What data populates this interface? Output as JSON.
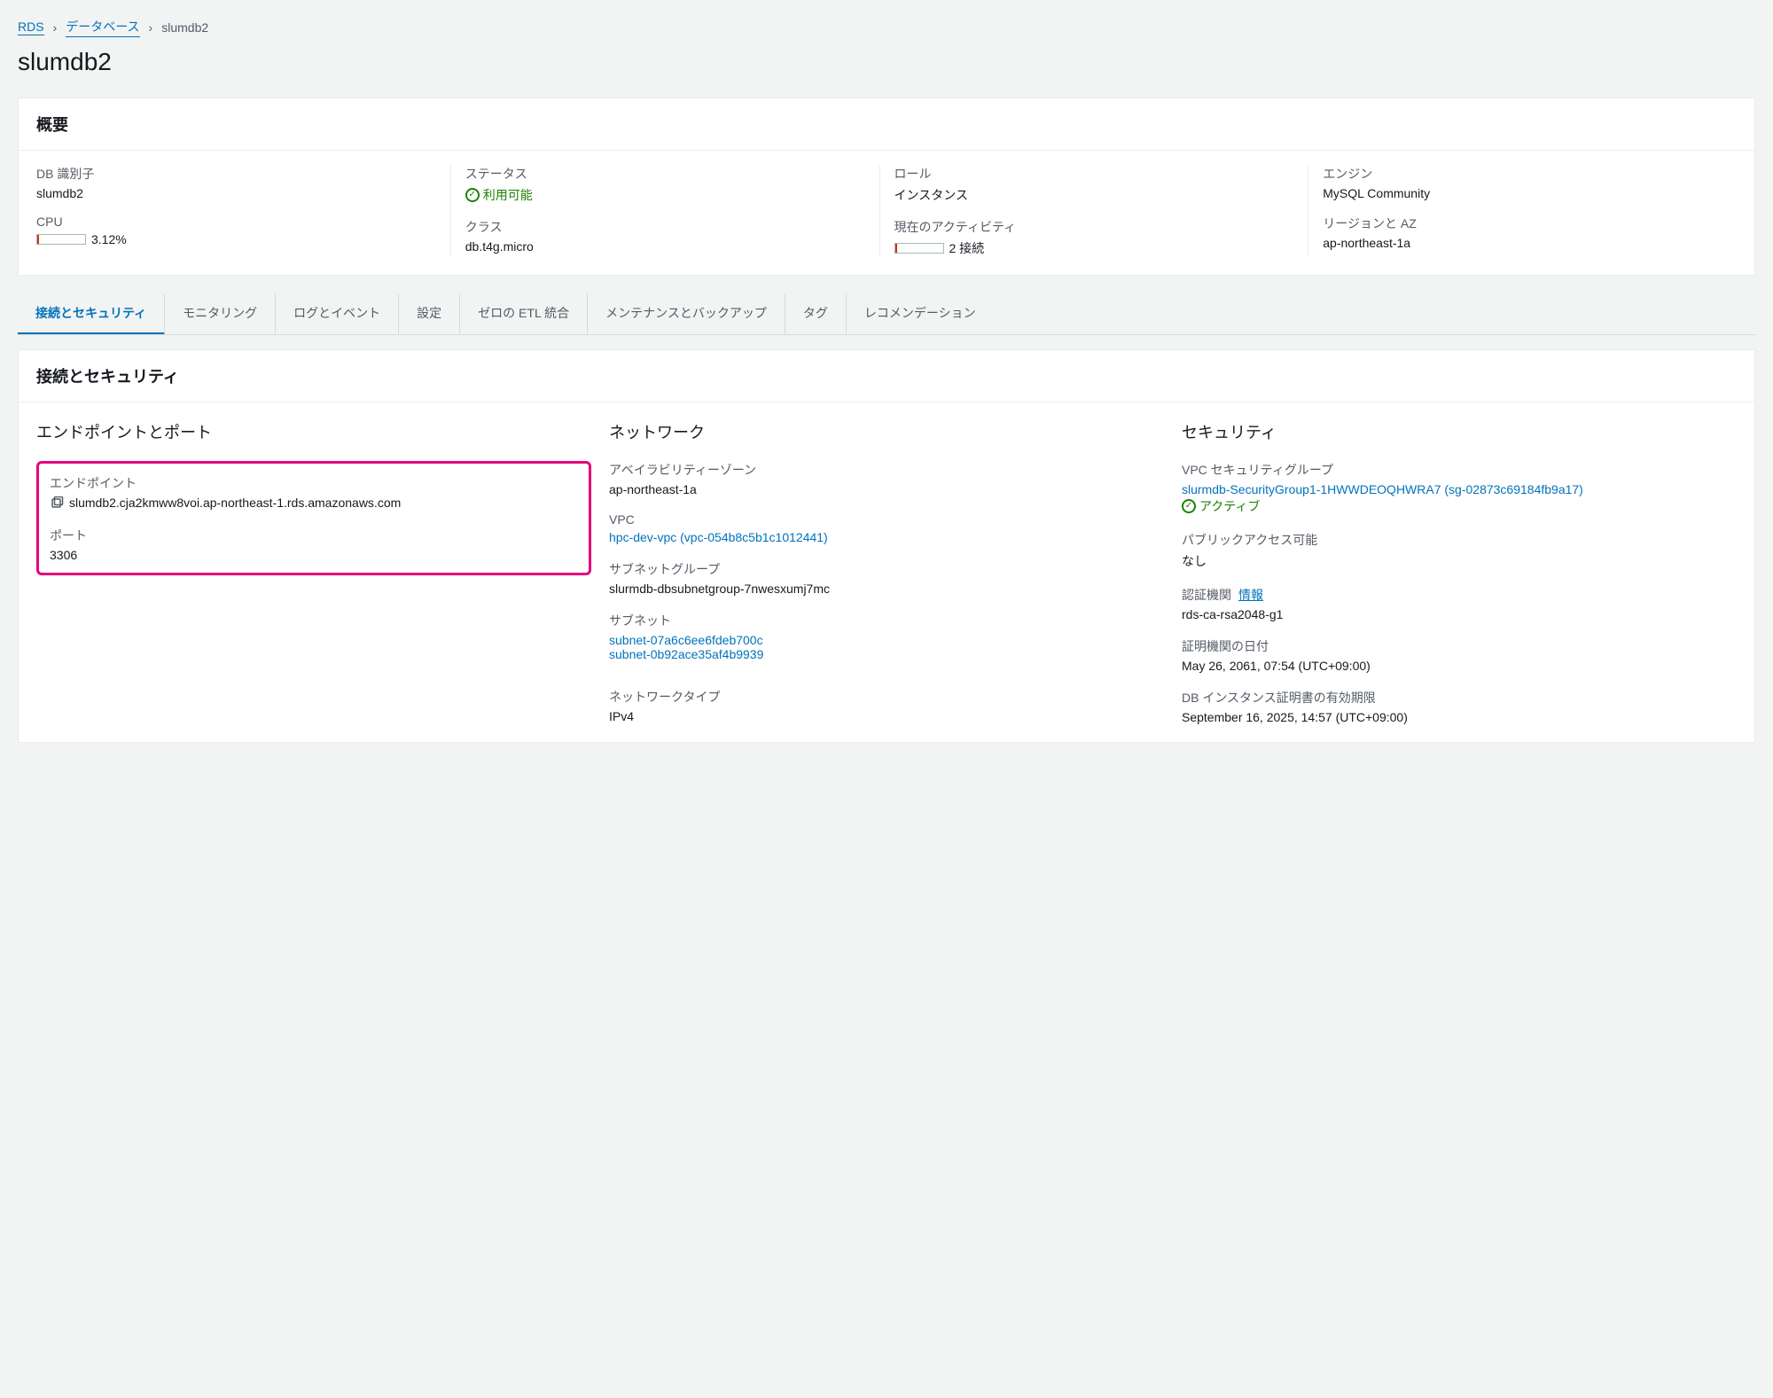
{
  "breadcrumb": {
    "items": [
      "RDS",
      "データベース"
    ],
    "current": "slumdb2"
  },
  "page_title": "slumdb2",
  "summary": {
    "header": "概要",
    "cols": [
      [
        {
          "label": "DB 識別子",
          "value": "slumdb2"
        },
        {
          "label": "CPU",
          "value": "3.12%",
          "meter_pct": 3.12
        }
      ],
      [
        {
          "label": "ステータス",
          "value": "利用可能",
          "status": "ok"
        },
        {
          "label": "クラス",
          "value": "db.t4g.micro"
        }
      ],
      [
        {
          "label": "ロール",
          "value": "インスタンス"
        },
        {
          "label": "現在のアクティビティ",
          "value": "2 接続",
          "meter_pct": 4
        }
      ],
      [
        {
          "label": "エンジン",
          "value": "MySQL Community"
        },
        {
          "label": "リージョンと AZ",
          "value": "ap-northeast-1a"
        }
      ]
    ]
  },
  "tabs": [
    "接続とセキュリティ",
    "モニタリング",
    "ログとイベント",
    "設定",
    "ゼロの ETL 統合",
    "メンテナンスとバックアップ",
    "タグ",
    "レコメンデーション"
  ],
  "active_tab": 0,
  "connectivity": {
    "header": "接続とセキュリティ",
    "endpoint_section": {
      "heading": "エンドポイントとポート",
      "endpoint_label": "エンドポイント",
      "endpoint_value": "slumdb2.cja2kmww8voi.ap-northeast-1.rds.amazonaws.com",
      "port_label": "ポート",
      "port_value": "3306"
    },
    "network_section": {
      "heading": "ネットワーク",
      "az_label": "アベイラビリティーゾーン",
      "az_value": "ap-northeast-1a",
      "vpc_label": "VPC",
      "vpc_link": "hpc-dev-vpc (vpc-054b8c5b1c1012441)",
      "subnet_group_label": "サブネットグループ",
      "subnet_group_value": "slurmdb-dbsubnetgroup-7nwesxumj7mc",
      "subnets_label": "サブネット",
      "subnets": [
        "subnet-07a6c6ee6fdeb700c",
        "subnet-0b92ace35af4b9939"
      ],
      "net_type_label": "ネットワークタイプ",
      "net_type_value": "IPv4"
    },
    "security_section": {
      "heading": "セキュリティ",
      "sg_label": "VPC セキュリティグループ",
      "sg_link": "slurmdb-SecurityGroup1-1HWWDEOQHWRA7 (sg-02873c69184fb9a17)",
      "sg_status": "アクティブ",
      "public_label": "パブリックアクセス可能",
      "public_value": "なし",
      "ca_label": "認証機関",
      "ca_info": "情報",
      "ca_value": "rds-ca-rsa2048-g1",
      "ca_date_label": "証明機関の日付",
      "ca_date_value": "May 26, 2061, 07:54 (UTC+09:00)",
      "cert_exp_label": "DB インスタンス証明書の有効期限",
      "cert_exp_value": "September 16, 2025, 14:57 (UTC+09:00)"
    }
  }
}
